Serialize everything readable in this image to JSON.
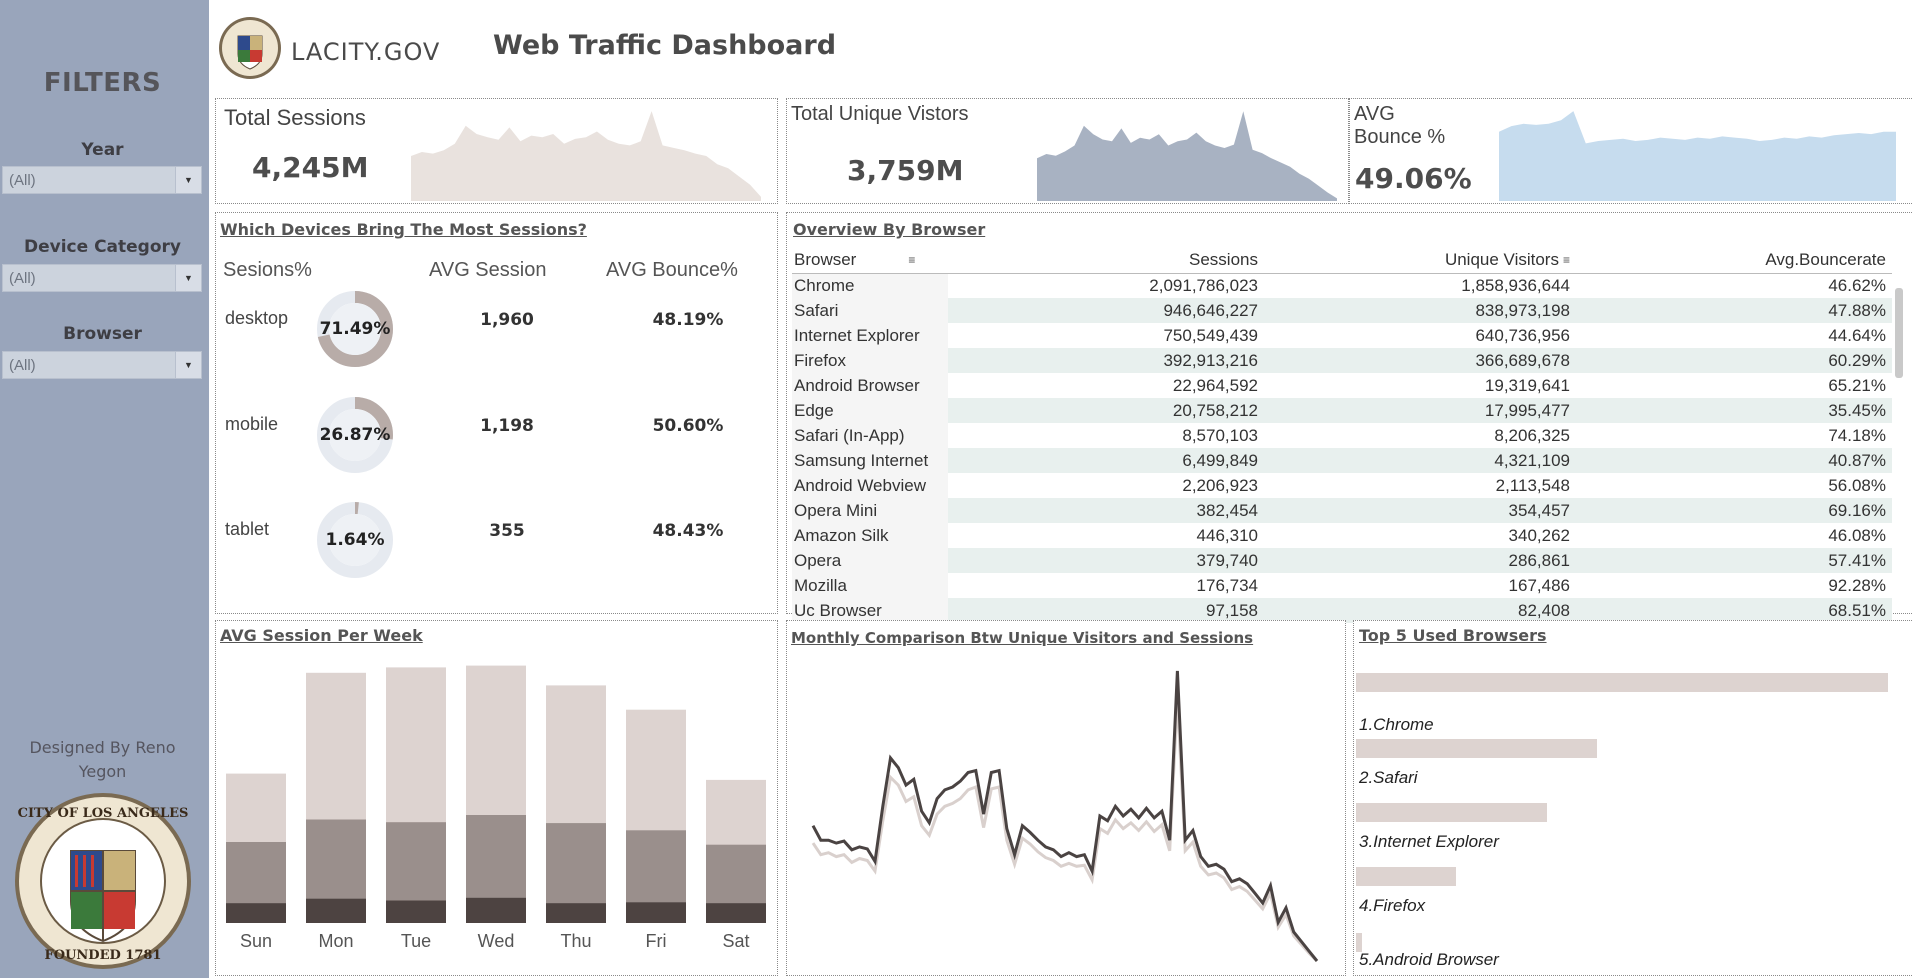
{
  "sidebar": {
    "title": "FILTERS",
    "filters": [
      {
        "label": "Year",
        "value": "(All)"
      },
      {
        "label": "Device Category",
        "value": "(All)"
      },
      {
        "label": "Browser",
        "value": "(All)"
      }
    ],
    "designer": [
      "Designed By Reno",
      "Yegon"
    ]
  },
  "header": {
    "logo_text": "LACITY.GOV",
    "title": "Web Traffic Dashboard"
  },
  "kpis": [
    {
      "title": "Total Sessions",
      "value": "4,245M",
      "color": "#e9e2de"
    },
    {
      "title": "Total Unique Vistors",
      "value": "3,759M",
      "color": "#a8b2c2"
    },
    {
      "title_lines": [
        "AVG",
        "Bounce %"
      ],
      "value": "49.06%",
      "color": "#c6dcee"
    }
  ],
  "devices": {
    "title": "Which Devices Bring The Most Sessions?",
    "headers": [
      "Sesions%",
      "AVG Session",
      "AVG Bounce%"
    ],
    "rows": [
      {
        "name": "desktop",
        "pct_label": "71.49%",
        "pct": 0.7149,
        "avg_session": "1,960",
        "avg_bounce": "48.19%"
      },
      {
        "name": "mobile",
        "pct_label": "26.87%",
        "pct": 0.2687,
        "avg_session": "1,198",
        "avg_bounce": "50.60%"
      },
      {
        "name": "tablet",
        "pct_label": "1.64%",
        "pct": 0.0164,
        "avg_session": "355",
        "avg_bounce": "48.43%"
      }
    ]
  },
  "browser_table": {
    "title": "Overview By Browser",
    "columns": [
      "Browser",
      "Sessions",
      "Unique Visitors",
      "Avg.Bouncerate"
    ],
    "rows": [
      [
        "Chrome",
        "2,091,786,023",
        "1,858,936,644",
        "46.62%"
      ],
      [
        "Safari",
        "946,646,227",
        "838,973,198",
        "47.88%"
      ],
      [
        "Internet Explorer",
        "750,549,439",
        "640,736,956",
        "44.64%"
      ],
      [
        "Firefox",
        "392,913,216",
        "366,689,678",
        "60.29%"
      ],
      [
        "Android Browser",
        "22,964,592",
        "19,319,641",
        "65.21%"
      ],
      [
        "Edge",
        "20,758,212",
        "17,995,477",
        "35.45%"
      ],
      [
        "Safari (In-App)",
        "8,570,103",
        "8,206,325",
        "74.18%"
      ],
      [
        "Samsung Internet",
        "6,499,849",
        "4,321,109",
        "40.87%"
      ],
      [
        "Android Webview",
        "2,206,923",
        "2,113,548",
        "56.08%"
      ],
      [
        "Opera Mini",
        "382,454",
        "354,457",
        "69.16%"
      ],
      [
        "Amazon Silk",
        "446,310",
        "340,262",
        "46.08%"
      ],
      [
        "Opera",
        "379,740",
        "286,861",
        "57.41%"
      ],
      [
        "Mozilla",
        "176,734",
        "167,486",
        "92.28%"
      ],
      [
        "Uc Browser",
        "97,158",
        "82,408",
        "68.51%"
      ]
    ]
  },
  "weekly": {
    "title": "AVG Session Per Week",
    "days": [
      "Sun",
      "Mon",
      "Tue",
      "Wed",
      "Thu",
      "Fri",
      "Sat"
    ],
    "totals": [
      166,
      278,
      284,
      286,
      264,
      237,
      159
    ],
    "mid": [
      90,
      115,
      112,
      120,
      111,
      103,
      87
    ],
    "low": [
      22,
      27,
      25,
      28,
      22,
      23,
      22
    ],
    "colors": [
      "#ddd3d0",
      "#9a8f8c",
      "#4d4341"
    ]
  },
  "monthly": {
    "title": "Monthly Comparison Btw Unique Visitors and Sessions",
    "sessions": [
      140,
      125,
      125,
      122,
      124,
      115,
      118,
      116,
      103,
      160,
      210,
      200,
      182,
      188,
      155,
      143,
      168,
      177,
      180,
      186,
      195,
      197,
      152,
      195,
      197,
      137,
      110,
      140,
      133,
      125,
      118,
      115,
      108,
      112,
      108,
      110,
      93,
      150,
      145,
      160,
      150,
      157,
      148,
      158,
      148,
      155,
      125,
      300,
      125,
      135,
      108,
      98,
      100,
      95,
      82,
      85,
      80,
      70,
      60,
      78,
      40,
      55,
      30,
      20,
      10,
      0
    ],
    "visitors": [
      122,
      110,
      112,
      108,
      110,
      102,
      106,
      104,
      93,
      145,
      190,
      182,
      165,
      170,
      140,
      130,
      152,
      160,
      163,
      168,
      177,
      180,
      138,
      178,
      180,
      125,
      100,
      127,
      121,
      113,
      107,
      104,
      98,
      101,
      98,
      99,
      84,
      137,
      132,
      146,
      137,
      143,
      135,
      144,
      134,
      141,
      114,
      272,
      114,
      123,
      98,
      89,
      91,
      86,
      74,
      77,
      72,
      63,
      54,
      70,
      35,
      48,
      26,
      17,
      8,
      0
    ],
    "colors": [
      "#4a4342",
      "#d9d0cd"
    ]
  },
  "top5": {
    "title": "Top 5 Used Browsers",
    "items": [
      {
        "label": "1.Chrome",
        "value": 2091786023
      },
      {
        "label": "2.Safari",
        "value": 946646227
      },
      {
        "label": "3.Internet Explorer",
        "value": 750549439
      },
      {
        "label": "4.Firefox",
        "value": 392913216
      },
      {
        "label": "5.Android Browser",
        "value": 22964592
      }
    ]
  },
  "sparks": {
    "sessions": [
      55,
      60,
      58,
      62,
      70,
      92,
      82,
      78,
      75,
      90,
      73,
      80,
      78,
      82,
      70,
      76,
      78,
      85,
      75,
      70,
      68,
      73,
      110,
      68,
      65,
      62,
      58,
      55,
      45,
      40,
      30,
      20,
      5
    ],
    "visitors": [
      50,
      55,
      53,
      58,
      65,
      88,
      78,
      72,
      70,
      85,
      68,
      74,
      72,
      78,
      65,
      70,
      72,
      80,
      70,
      65,
      62,
      66,
      105,
      60,
      56,
      50,
      45,
      40,
      32,
      26,
      18,
      10,
      3
    ],
    "bounce": [
      60,
      65,
      67,
      66,
      67,
      70,
      78,
      50,
      52,
      53,
      54,
      52,
      53,
      55,
      54,
      53,
      55,
      54,
      56,
      55,
      54,
      52,
      53,
      55,
      54,
      56,
      55,
      57,
      58,
      59,
      58,
      60,
      60
    ]
  }
}
